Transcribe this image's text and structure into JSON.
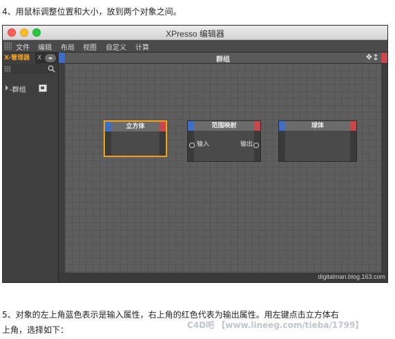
{
  "instructions": {
    "step4": "4、用鼠标调整位置和大小，放到两个对象之间。",
    "step5_line1": "5、对象的左上角蓝色表示是输入属性，右上角的红色代表为输出属性。用左键点击立方体右",
    "step5_line2": "上角，选择如下："
  },
  "window": {
    "title": "XPresso 编辑器",
    "menu": [
      "文件",
      "编辑",
      "布局",
      "视图",
      "自定义",
      "计算"
    ]
  },
  "left_panel": {
    "active_tab": "X-管理器",
    "second_tab": "X",
    "nav_glyph": "◂▸",
    "tree_item": "-群组"
  },
  "editor": {
    "title": "群组",
    "move_glyph": "✥",
    "updown_glyph": "↕",
    "watermark": "digitalman.blog.163.com",
    "nodes": [
      {
        "title": "立方体",
        "selected": true
      },
      {
        "title": "范围映射",
        "input_label": "输入",
        "output_label": "输出"
      },
      {
        "title": "球体"
      }
    ]
  },
  "footer_brand": "C4D吧 【www.lineeg.com/tieba/1799】",
  "colors": {
    "input_port": "#3d6fc7",
    "output_port": "#c9474b",
    "selection": "#f0a316",
    "active_tab_text": "#f6a623"
  }
}
